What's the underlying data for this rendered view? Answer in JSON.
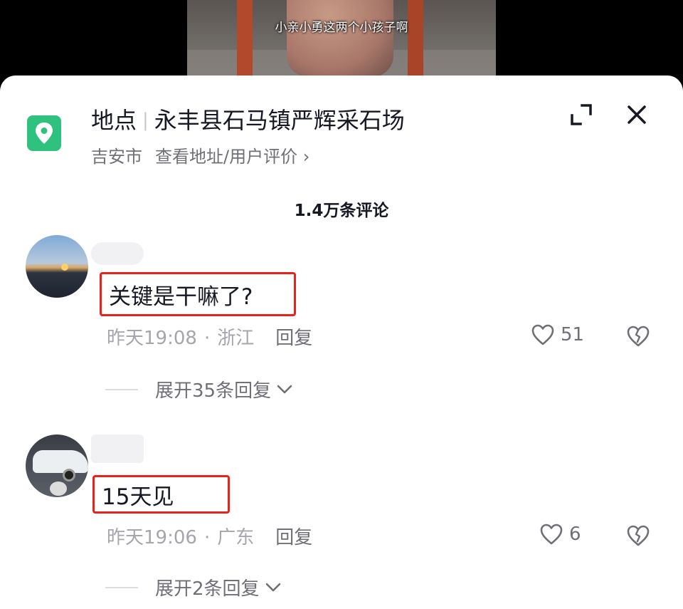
{
  "video": {
    "subtitle": "小亲小勇这两个小孩子啊"
  },
  "location_header": {
    "label": "地点",
    "name": "永丰县石马镇严辉采石场",
    "city": "吉安市",
    "link": "查看地址/用户评价 ›",
    "icon": "map-pin-icon",
    "icon_color": "#2ec27e"
  },
  "comments_count": "1.4万条评论",
  "comments": [
    {
      "avatar": "sunset-lake-avatar",
      "text": "关键是干嘛了?",
      "time": "昨天19:08",
      "sep": "·",
      "region": "浙江",
      "reply_label": "回复",
      "likes": "51",
      "expand_label": "展开35条回复"
    },
    {
      "avatar": "white-car-avatar",
      "text": "15天见",
      "time": "昨天19:06",
      "sep": "·",
      "region": "广东",
      "reply_label": "回复",
      "likes": "6",
      "expand_label": "展开2条回复"
    }
  ],
  "colors": {
    "highlight_box": "#e8231c",
    "primary_text": "#161823",
    "secondary_text": "#a5a6ab"
  }
}
